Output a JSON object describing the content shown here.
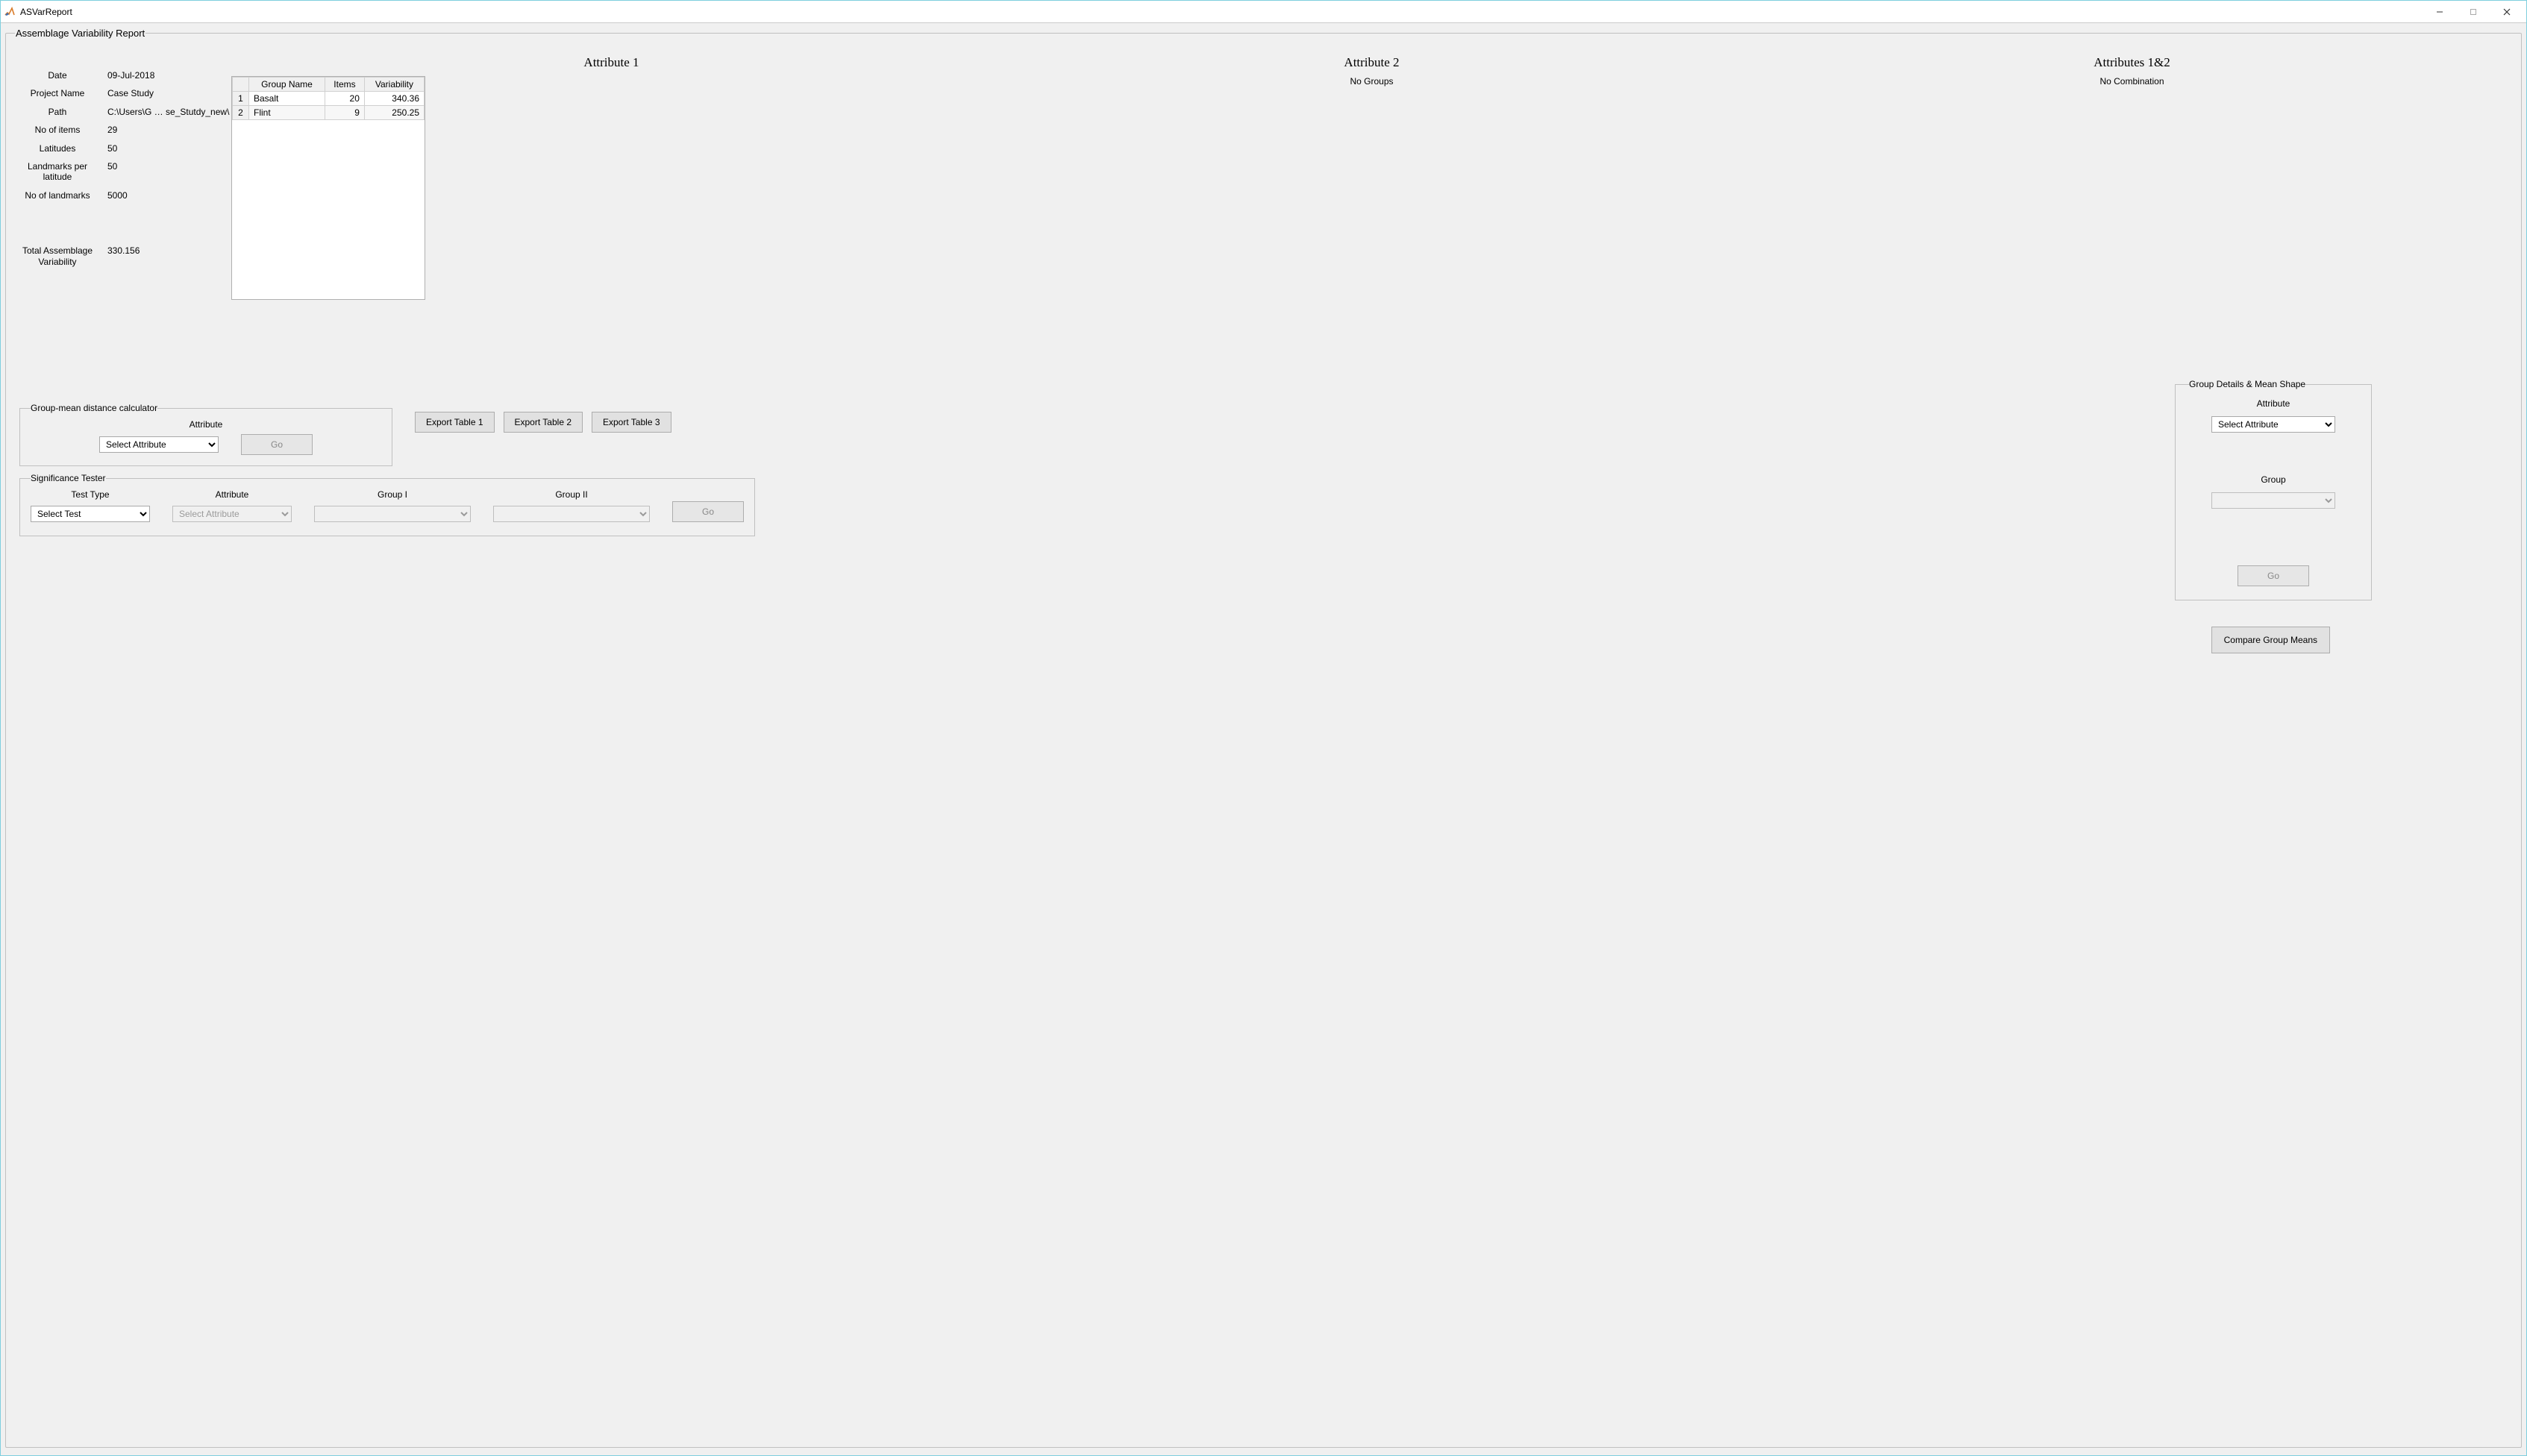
{
  "window": {
    "title": "ASVarReport"
  },
  "report": {
    "frame_title": "Assemblage Variability Report",
    "meta": {
      "date_label": "Date",
      "date_value": "09-Jul-2018",
      "project_label": "Project Name",
      "project_value": "Case Study",
      "path_label": "Path",
      "path_value_left": "C:\\Users\\G …",
      "path_value_right": "se_Stutdy_new\\",
      "items_label": "No of items",
      "items_value": "29",
      "lat_label": "Latitudes",
      "lat_value": "50",
      "lpl_label": "Landmarks per latitude",
      "lpl_value": "50",
      "lm_label": "No of landmarks",
      "lm_value": "5000",
      "tav_label": "Total Assemblage Variability",
      "tav_value": "330.156"
    },
    "columns": {
      "attr1": {
        "title": "Attribute 1",
        "table": {
          "headers": {
            "group": "Group Name",
            "items": "Items",
            "var": "Variability"
          },
          "rows": [
            {
              "n": "1",
              "name": "Basalt",
              "items": "20",
              "var": "340.36"
            },
            {
              "n": "2",
              "name": "Flint",
              "items": "9",
              "var": "250.25"
            }
          ]
        }
      },
      "attr2": {
        "title": "Attribute 2",
        "message": "No Groups"
      },
      "attr12": {
        "title": "Attributes 1&2",
        "message": "No Combination"
      }
    },
    "exports": {
      "t1": "Export Table 1",
      "t2": "Export Table 2",
      "t3": "Export Table 3"
    },
    "gmdc": {
      "frame": "Group-mean distance calculator",
      "attr_label": "Attribute",
      "attr_select": "Select Attribute",
      "go": "Go"
    },
    "sigt": {
      "frame": "Significance Tester",
      "test_type_label": "Test Type",
      "test_type_select": "Select Test",
      "attr_label": "Attribute",
      "attr_select": "Select Attribute",
      "g1_label": "Group I",
      "g2_label": "Group II",
      "go": "Go"
    },
    "gdms": {
      "frame": "Group Details & Mean Shape",
      "attr_label": "Attribute",
      "attr_select": "Select Attribute",
      "group_label": "Group",
      "go": "Go"
    },
    "compare": {
      "label": "Compare Group Means"
    }
  }
}
